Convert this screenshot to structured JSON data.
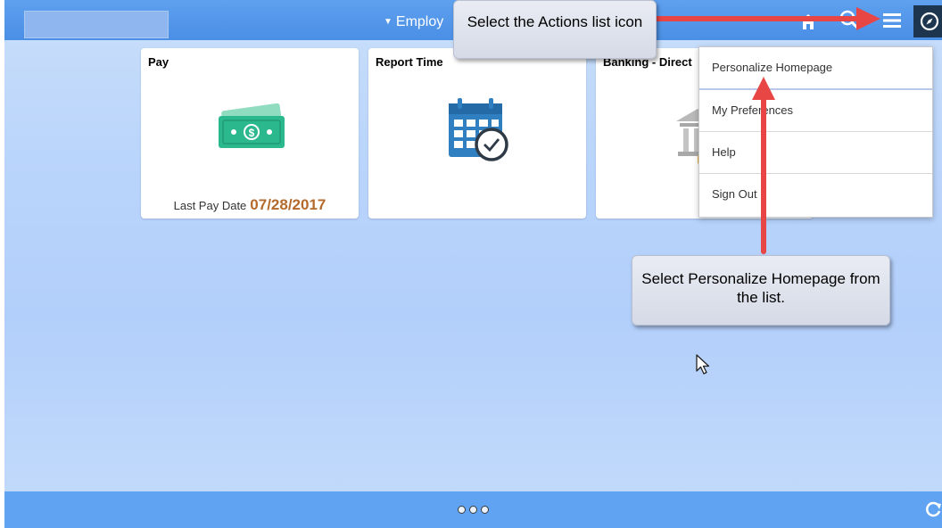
{
  "header": {
    "homepage_label": "Employ",
    "icons": {
      "home": "home-icon",
      "search": "search-icon",
      "actions": "actions-list-icon",
      "navbar": "compass-icon"
    }
  },
  "tiles": [
    {
      "title": "Pay",
      "meta_label": "Last Pay Date",
      "meta_value": "07/28/2017",
      "icon": "money-icon"
    },
    {
      "title": "Report Time",
      "icon": "calendar-clock-icon"
    },
    {
      "title": "Banking - Direct",
      "icon": "bank-icon"
    }
  ],
  "actions_menu": {
    "items": [
      {
        "label": "Personalize Homepage"
      },
      {
        "label": "My Preferences"
      },
      {
        "label": "Help"
      },
      {
        "label": "Sign Out"
      }
    ]
  },
  "callouts": {
    "top": "Select the Actions list icon",
    "bottom": "Select Personalize Homepage from the list."
  },
  "colors": {
    "header": "#4a8fe6",
    "page_bg": "#b9d5fb",
    "footer": "#61a3f3",
    "pay_date": "#b46a2c",
    "arrow": "#e84545"
  }
}
